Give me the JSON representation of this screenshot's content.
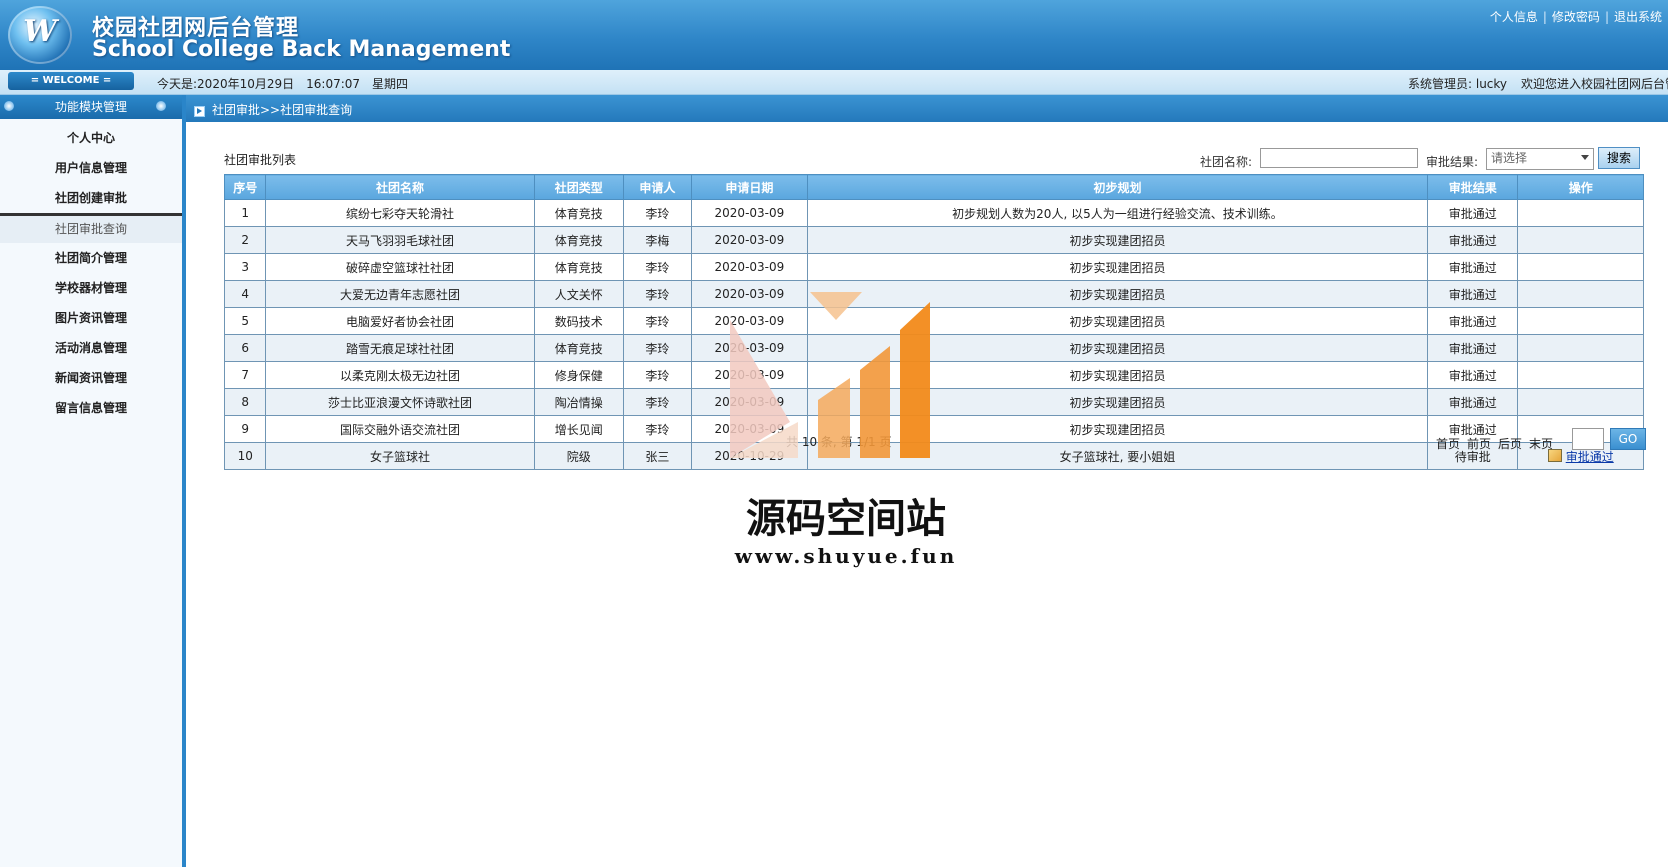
{
  "header": {
    "logo_letter": "W",
    "title_cn": "校园社团网后台管理",
    "title_en": "School College Back Management",
    "links": {
      "profile": "个人信息",
      "change_password": "修改密码",
      "logout": "退出系统",
      "separator": "|"
    }
  },
  "infobar": {
    "welcome": "= WELCOME =",
    "date_prefix": "今天是:",
    "date": "2020年10月29日",
    "time": "16:07:07",
    "weekday": "星期四",
    "admin_label": "系统管理员: lucky",
    "welcome_message": "欢迎您进入校园社团网后台管理"
  },
  "sidebar": {
    "title": "功能模块管理",
    "items": [
      {
        "label": "个人中心"
      },
      {
        "label": "用户信息管理"
      },
      {
        "label": "社团创建审批"
      },
      {
        "label": "社团审批查询"
      },
      {
        "label": "社团简介管理"
      },
      {
        "label": "学校器材管理"
      },
      {
        "label": "图片资讯管理"
      },
      {
        "label": "活动消息管理"
      },
      {
        "label": "新闻资讯管理"
      },
      {
        "label": "留言信息管理"
      }
    ]
  },
  "breadcrumb": {
    "text": "社团审批>>社团审批查询"
  },
  "main": {
    "list_title": "社团审批列表",
    "search": {
      "name_label": "社团名称:",
      "name_value": "",
      "result_label": "审批结果:",
      "result_selected": "请选择",
      "button": "搜索"
    },
    "table": {
      "headers": [
        "序号",
        "社团名称",
        "社团类型",
        "申请人",
        "申请日期",
        "初步规划",
        "审批结果",
        "操作"
      ],
      "rows": [
        {
          "no": "1",
          "name": "缤纷七彩夺天轮滑社",
          "type": "体育竞技",
          "applicant": "李玲",
          "date": "2020-03-09",
          "plan": "初步规划人数为20人, 以5人为一组进行经验交流、技术训练。",
          "result": "审批通过",
          "action": ""
        },
        {
          "no": "2",
          "name": "天马飞羽羽毛球社团",
          "type": "体育竞技",
          "applicant": "李梅",
          "date": "2020-03-09",
          "plan": "初步实现建团招员",
          "result": "审批通过",
          "action": ""
        },
        {
          "no": "3",
          "name": "破碎虚空篮球社社团",
          "type": "体育竞技",
          "applicant": "李玲",
          "date": "2020-03-09",
          "plan": "初步实现建团招员",
          "result": "审批通过",
          "action": ""
        },
        {
          "no": "4",
          "name": "大爱无边青年志愿社团",
          "type": "人文关怀",
          "applicant": "李玲",
          "date": "2020-03-09",
          "plan": "初步实现建团招员",
          "result": "审批通过",
          "action": ""
        },
        {
          "no": "5",
          "name": "电脑爱好者协会社团",
          "type": "数码技术",
          "applicant": "李玲",
          "date": "2020-03-09",
          "plan": "初步实现建团招员",
          "result": "审批通过",
          "action": ""
        },
        {
          "no": "6",
          "name": "踏雪无痕足球社社团",
          "type": "体育竞技",
          "applicant": "李玲",
          "date": "2020-03-09",
          "plan": "初步实现建团招员",
          "result": "审批通过",
          "action": ""
        },
        {
          "no": "7",
          "name": "以柔克刚太极无边社团",
          "type": "修身保健",
          "applicant": "李玲",
          "date": "2020-03-09",
          "plan": "初步实现建团招员",
          "result": "审批通过",
          "action": ""
        },
        {
          "no": "8",
          "name": "莎士比亚浪漫文怀诗歌社团",
          "type": "陶冶情操",
          "applicant": "李玲",
          "date": "2020-03-09",
          "plan": "初步实现建团招员",
          "result": "审批通过",
          "action": ""
        },
        {
          "no": "9",
          "name": "国际交融外语交流社团",
          "type": "增长见闻",
          "applicant": "李玲",
          "date": "2020-03-09",
          "plan": "初步实现建团招员",
          "result": "审批通过",
          "action": ""
        },
        {
          "no": "10",
          "name": "女子篮球社",
          "type": "院级",
          "applicant": "张三",
          "date": "2020-10-29",
          "plan": "女子篮球社, 要小姐姐",
          "result": "待审批",
          "action": "审批通过"
        }
      ]
    },
    "pager": {
      "summary": "共 10 条, 第 1/1 页",
      "first": "首页",
      "prev": "前页",
      "next": "后页",
      "last": "末页",
      "page_value": "",
      "go": "GO"
    }
  },
  "watermark": {
    "title": "源码空间站",
    "url": "www.shuyue.fun"
  },
  "colors": {
    "header_blue": "#2f86c8",
    "nav_blue": "#2479bb",
    "table_header": "#5aa6de",
    "watermark_orange": "#f28a1a",
    "watermark_pink": "#f2c9c0"
  }
}
